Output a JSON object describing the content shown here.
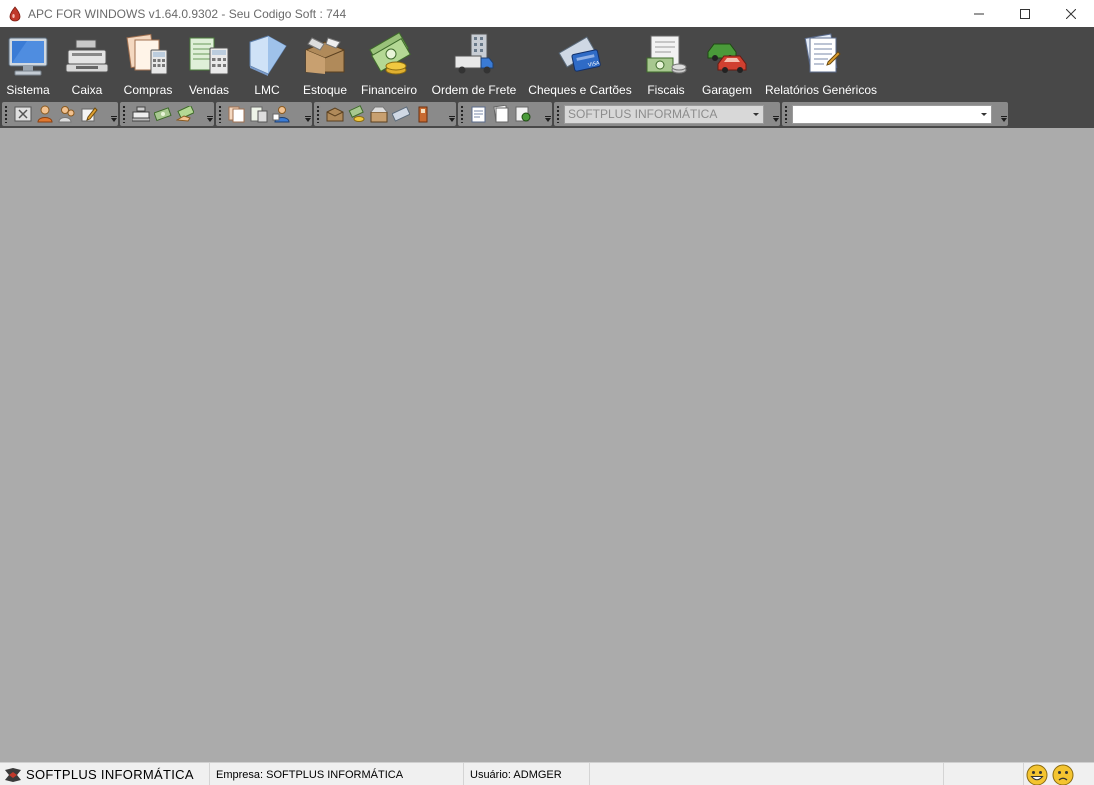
{
  "window": {
    "title": "APC FOR WINDOWS v1.64.0.9302 - Seu Codigo Soft : 744"
  },
  "main_menu": [
    {
      "id": "sistema",
      "label": "Sistema",
      "icon": "monitor-icon"
    },
    {
      "id": "caixa",
      "label": "Caixa",
      "icon": "cash-register-icon"
    },
    {
      "id": "compras",
      "label": "Compras",
      "icon": "calculator-documents-icon"
    },
    {
      "id": "vendas",
      "label": "Vendas",
      "icon": "calculator-sheet-icon"
    },
    {
      "id": "lmc",
      "label": "LMC",
      "icon": "book-icon"
    },
    {
      "id": "estoque",
      "label": "Estoque",
      "icon": "box-icon"
    },
    {
      "id": "financeiro",
      "label": "Financeiro",
      "icon": "money-coins-icon"
    },
    {
      "id": "ordem_frete",
      "label": "Ordem de Frete",
      "icon": "truck-building-icon"
    },
    {
      "id": "cheques_cartoes",
      "label": "Cheques e Cartões",
      "icon": "cheque-card-icon"
    },
    {
      "id": "fiscais",
      "label": "Fiscais",
      "icon": "fiscal-money-icon"
    },
    {
      "id": "garagem",
      "label": "Garagem",
      "icon": "cars-icon"
    },
    {
      "id": "relatorios",
      "label": "Relatórios Genéricos",
      "icon": "report-icon"
    }
  ],
  "toolbar": {
    "company_combo": "SOFTPLUS INFORMÁTICA",
    "second_combo": ""
  },
  "status": {
    "brand": "SOFTPLUS INFORMÁTICA",
    "empresa": "Empresa: SOFTPLUS INFORMÁTICA",
    "usuario": "Usuário: ADMGER"
  },
  "colors": {
    "toolbar_bg": "#484848",
    "toolbar_group": "#8a8a8a",
    "mdi_bg": "#ababab",
    "statusbar_bg": "#f0f0f0"
  }
}
